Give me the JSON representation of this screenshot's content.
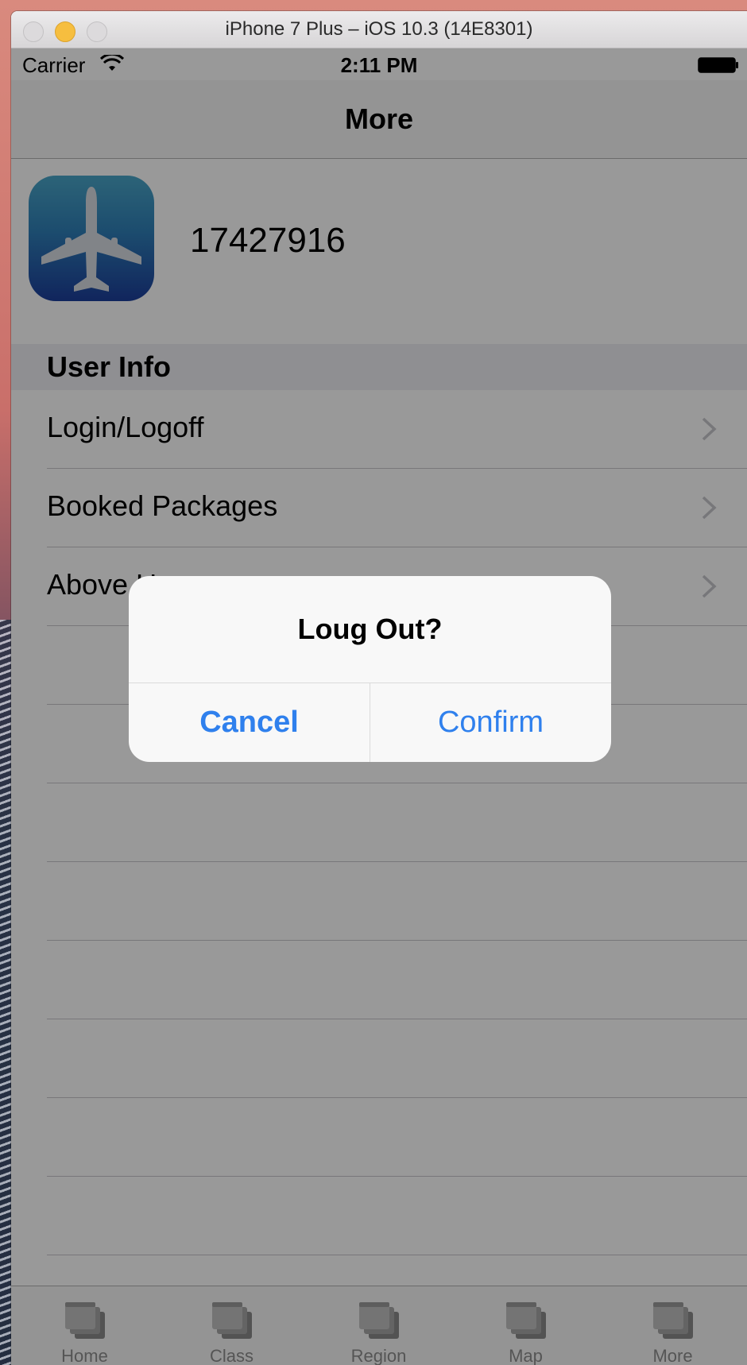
{
  "window": {
    "title": "iPhone 7 Plus – iOS 10.3 (14E8301)"
  },
  "status_bar": {
    "carrier": "Carrier",
    "time": "2:11 PM"
  },
  "nav": {
    "title": "More"
  },
  "profile": {
    "user_id": "17427916"
  },
  "section": {
    "title": "User Info"
  },
  "rows": [
    {
      "label": "Login/Logoff"
    },
    {
      "label": "Booked Packages"
    },
    {
      "label": "Above Us"
    }
  ],
  "alert": {
    "title": "Loug Out?",
    "cancel_label": "Cancel",
    "confirm_label": "Confirm"
  },
  "tabs": [
    {
      "label": "Home",
      "icon": "placeholder-icon"
    },
    {
      "label": "Class",
      "icon": "placeholder-icon"
    },
    {
      "label": "Region",
      "icon": "placeholder-icon"
    },
    {
      "label": "Map",
      "icon": "placeholder-icon"
    },
    {
      "label": "More",
      "icon": "placeholder-icon"
    }
  ],
  "colors": {
    "accent": "#2f80ed",
    "app_icon_top": "#4aa6c8",
    "app_icon_bottom": "#1c3e9b",
    "traffic_minimize": "#f6be3f"
  }
}
